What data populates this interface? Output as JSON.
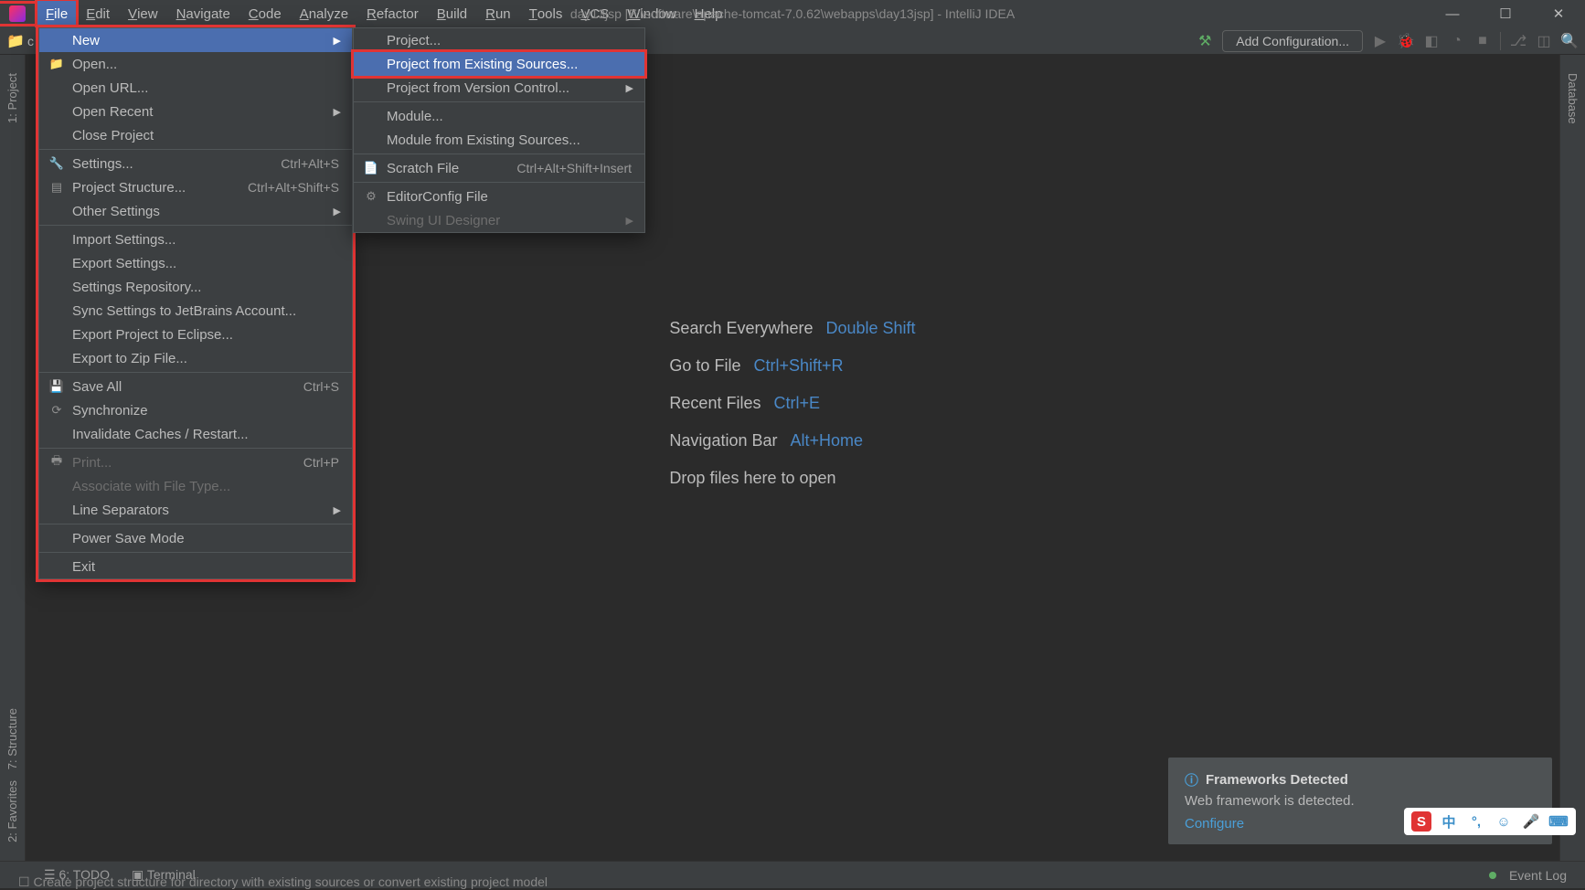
{
  "title": "day13jsp [E:\\software\\apache-tomcat-7.0.62\\webapps\\day13jsp] - IntelliJ IDEA",
  "menubar": [
    "File",
    "Edit",
    "View",
    "Navigate",
    "Code",
    "Analyze",
    "Refactor",
    "Build",
    "Run",
    "Tools",
    "VCS",
    "Window",
    "Help"
  ],
  "toolbar": {
    "add_config": "Add Configuration..."
  },
  "left_tabs": {
    "project": "1: Project",
    "structure": "7: Structure",
    "favorites": "2: Favorites"
  },
  "right_tabs": {
    "database": "Database"
  },
  "welcome": [
    {
      "label": "Search Everywhere",
      "kbd": "Double Shift"
    },
    {
      "label": "Go to File",
      "kbd": "Ctrl+Shift+R"
    },
    {
      "label": "Recent Files",
      "kbd": "Ctrl+E"
    },
    {
      "label": "Navigation Bar",
      "kbd": "Alt+Home"
    },
    {
      "label": "Drop files here to open",
      "kbd": ""
    }
  ],
  "file_menu": [
    {
      "label": "New",
      "arrow": true,
      "highlight": true
    },
    {
      "label": "Open...",
      "icon": "folder"
    },
    {
      "label": "Open URL..."
    },
    {
      "label": "Open Recent",
      "arrow": true
    },
    {
      "label": "Close Project"
    },
    {
      "sep": true
    },
    {
      "label": "Settings...",
      "kbd": "Ctrl+Alt+S",
      "icon": "wrench"
    },
    {
      "label": "Project Structure...",
      "kbd": "Ctrl+Alt+Shift+S",
      "icon": "structure"
    },
    {
      "label": "Other Settings",
      "arrow": true
    },
    {
      "sep": true
    },
    {
      "label": "Import Settings..."
    },
    {
      "label": "Export Settings..."
    },
    {
      "label": "Settings Repository..."
    },
    {
      "label": "Sync Settings to JetBrains Account..."
    },
    {
      "label": "Export Project to Eclipse..."
    },
    {
      "label": "Export to Zip File..."
    },
    {
      "sep": true
    },
    {
      "label": "Save All",
      "kbd": "Ctrl+S",
      "icon": "save"
    },
    {
      "label": "Synchronize",
      "icon": "sync"
    },
    {
      "label": "Invalidate Caches / Restart..."
    },
    {
      "sep": true
    },
    {
      "label": "Print...",
      "kbd": "Ctrl+P",
      "disabled": true,
      "icon": "print"
    },
    {
      "label": "Associate with File Type...",
      "disabled": true
    },
    {
      "label": "Line Separators",
      "arrow": true
    },
    {
      "sep": true
    },
    {
      "label": "Power Save Mode"
    },
    {
      "sep": true
    },
    {
      "label": "Exit"
    }
  ],
  "new_submenu": [
    {
      "label": "Project..."
    },
    {
      "label": "Project from Existing Sources...",
      "highlight": true,
      "redbox": true
    },
    {
      "label": "Project from Version Control...",
      "arrow": true
    },
    {
      "sep": true
    },
    {
      "label": "Module..."
    },
    {
      "label": "Module from Existing Sources..."
    },
    {
      "sep": true
    },
    {
      "label": "Scratch File",
      "kbd": "Ctrl+Alt+Shift+Insert",
      "icon": "scratch"
    },
    {
      "sep": true
    },
    {
      "label": "EditorConfig File",
      "icon": "gear"
    },
    {
      "label": "Swing UI Designer",
      "arrow": true,
      "disabled": true
    }
  ],
  "statusbar": {
    "todo": "6: TODO",
    "terminal": "Terminal",
    "eventlog": "Event Log"
  },
  "hint": "Create project structure for directory with existing sources or convert existing project model",
  "notif": {
    "title": "Frameworks Detected",
    "body": "Web framework is detected.",
    "link": "Configure"
  },
  "ime": {
    "lang": "中"
  }
}
